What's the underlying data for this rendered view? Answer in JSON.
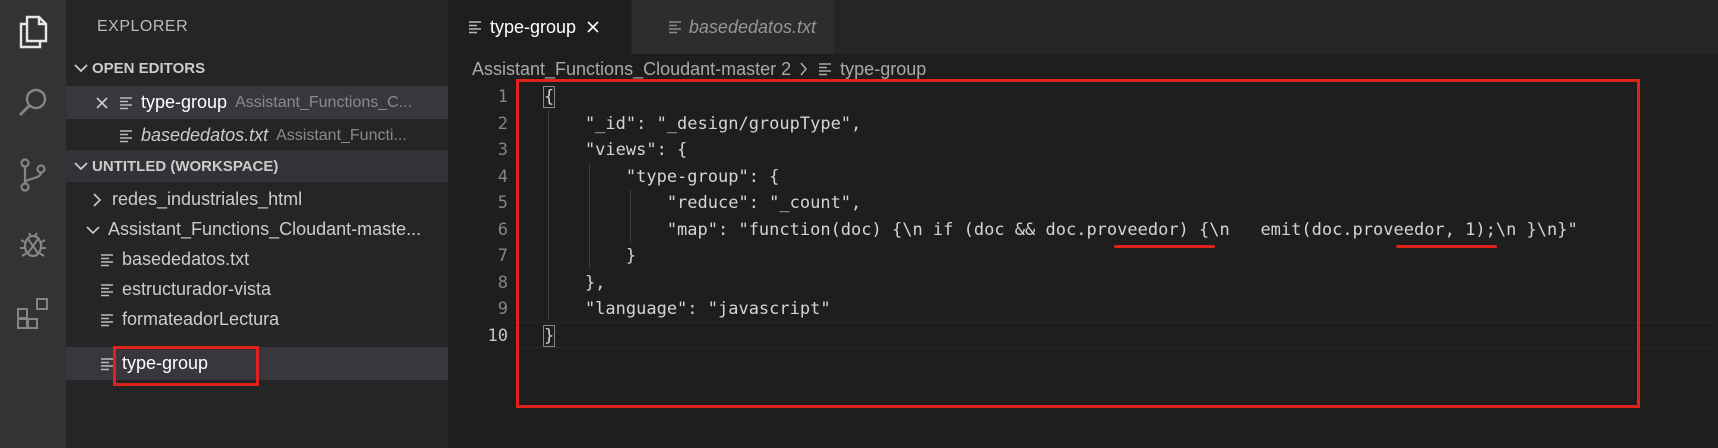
{
  "activity_bar": {
    "icons": [
      "files-icon",
      "search-icon",
      "source-control-icon",
      "debug-icon",
      "extensions-icon"
    ]
  },
  "sidebar": {
    "title": "EXPLORER",
    "open_editors": {
      "header": "OPEN EDITORS",
      "items": [
        {
          "name": "type-group",
          "path": "Assistant_Functions_C..."
        },
        {
          "name": "basededatos.txt",
          "path": "Assistant_Functi..."
        }
      ]
    },
    "workspace": {
      "header": "UNTITLED (WORKSPACE)",
      "folders": [
        {
          "name": "redes_industriales_html"
        },
        {
          "name": "Assistant_Functions_Cloudant-maste..."
        }
      ],
      "files": [
        "basededatos.txt",
        "estructurador-vista",
        "formateadorLectura",
        "type-group"
      ]
    }
  },
  "editor": {
    "tabs": [
      {
        "label": "type-group"
      },
      {
        "label": "basededatos.txt"
      }
    ],
    "breadcrumb": {
      "folder": "Assistant_Functions_Cloudant-master 2",
      "file": "type-group"
    },
    "line_numbers": [
      "1",
      "2",
      "3",
      "4",
      "5",
      "6",
      "7",
      "8",
      "9",
      "10"
    ],
    "lines": [
      "{",
      "    \"_id\": \"_design/groupType\",",
      "    \"views\": {",
      "        \"type-group\": {",
      "            \"reduce\": \"_count\",",
      "            \"map\": \"function(doc) {\\n if (doc && doc.proveedor) {\\n   emit(doc.proveedor, 1);\\n }\\n}\"",
      "        }",
      "    },",
      "    \"language\": \"javascript\"",
      "}"
    ]
  },
  "colors": {
    "activity_bar": "#333333",
    "sidebar": "#252526",
    "editor": "#1e1e1e",
    "annotation_red": "#e0221c"
  }
}
